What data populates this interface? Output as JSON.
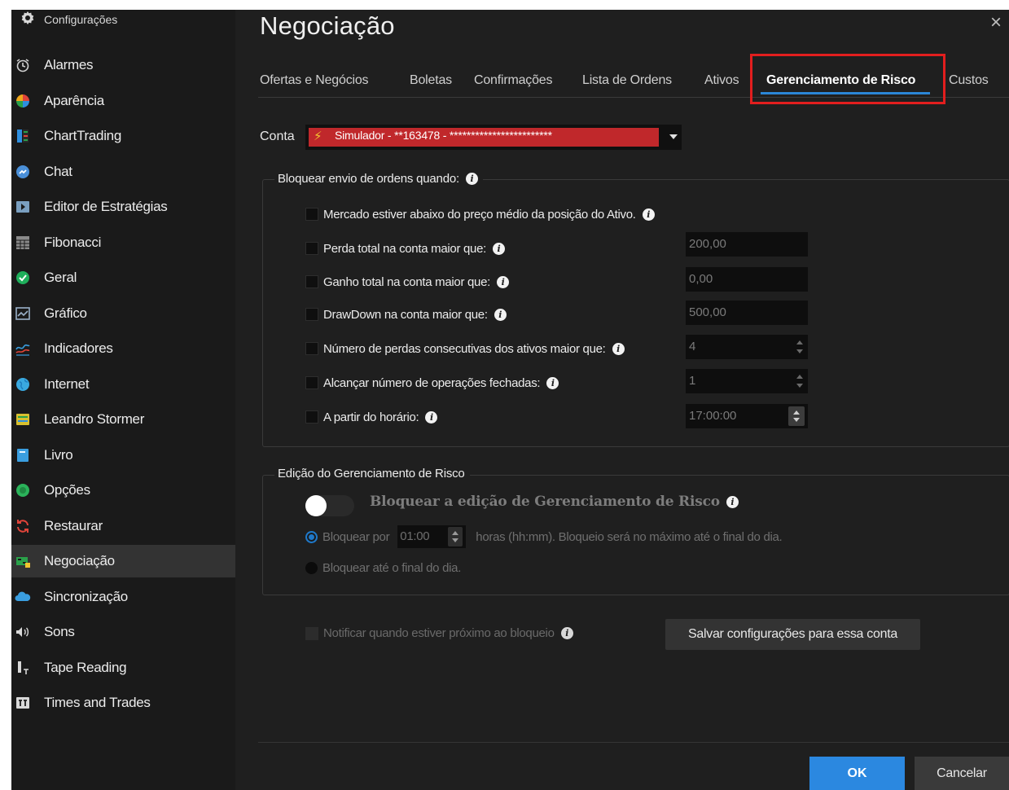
{
  "sidebar": {
    "header": {
      "label": "Configurações",
      "icon": "gear-icon"
    },
    "items": [
      {
        "label": "Alarmes",
        "icon": "alarm-clock-icon",
        "color": "#d0d0d0"
      },
      {
        "label": "Aparência",
        "icon": "palette-pie-icon",
        "color": "#f08a1c"
      },
      {
        "label": "ChartTrading",
        "icon": "chart-trading-icon",
        "color": "#2aa14a"
      },
      {
        "label": "Chat",
        "icon": "chat-bubble-icon",
        "color": "#4a8fd8"
      },
      {
        "label": "Editor de Estratégias",
        "icon": "play-box-icon",
        "color": "#7a9fc0"
      },
      {
        "label": "Fibonacci",
        "icon": "fibonacci-grid-icon",
        "color": "#8a8a8a"
      },
      {
        "label": "Geral",
        "icon": "check-circle-icon",
        "color": "#1fae5b"
      },
      {
        "label": "Gráfico",
        "icon": "line-chart-icon",
        "color": "#9ab0c8"
      },
      {
        "label": "Indicadores",
        "icon": "indicator-lines-icon",
        "color": "#3a9ee0"
      },
      {
        "label": "Internet",
        "icon": "globe-icon",
        "color": "#3aa9e0"
      },
      {
        "label": "Leandro Stormer",
        "icon": "user-card-icon",
        "color": "#d8c030"
      },
      {
        "label": "Livro",
        "icon": "book-icon",
        "color": "#3a9ee0"
      },
      {
        "label": "Opções",
        "icon": "options-circle-icon",
        "color": "#2bb35a"
      },
      {
        "label": "Restaurar",
        "icon": "restore-arrows-icon",
        "color": "#e0443a"
      },
      {
        "label": "Negociação",
        "icon": "trading-bars-icon",
        "color": "#2aa14a",
        "active": true
      },
      {
        "label": "Sincronização",
        "icon": "cloud-icon",
        "color": "#3a9ee0"
      },
      {
        "label": "Sons",
        "icon": "speaker-icon",
        "color": "#d8d8d8"
      },
      {
        "label": "Tape Reading",
        "icon": "tape-reading-icon",
        "color": "#d8d8d8"
      },
      {
        "label": "Times and Trades",
        "icon": "times-trades-icon",
        "color": "#d8d8d8"
      }
    ]
  },
  "main": {
    "title": "Negociação",
    "close_glyph": "×",
    "tabs": [
      {
        "label": "Ofertas e Negócios"
      },
      {
        "label": "Boletas"
      },
      {
        "label": "Confirmações"
      },
      {
        "label": "Lista de Ordens"
      },
      {
        "label": "Ativos"
      },
      {
        "label": "Gerenciamento de Risco",
        "active": true
      },
      {
        "label": "Custos"
      }
    ],
    "conta": {
      "label": "Conta",
      "value": "Simulador - **163478 - ************************",
      "color": "#c0282b"
    },
    "block_group": {
      "title": "Bloquear envio de ordens quando:",
      "rows": [
        {
          "label": "Mercado estiver abaixo do preço médio da posição do Ativo.",
          "checked": false
        },
        {
          "label": "Perda total na conta maior que:",
          "checked": false,
          "value": "200,00"
        },
        {
          "label": "Ganho total na conta maior que:",
          "checked": false,
          "value": "0,00"
        },
        {
          "label": "DrawDown na conta maior que:",
          "checked": false,
          "value": "500,00"
        },
        {
          "label": "Número de perdas consecutivas dos ativos maior que:",
          "checked": false,
          "value": "4"
        },
        {
          "label": "Alcançar número de operações fechadas:",
          "checked": false,
          "value": "1"
        },
        {
          "label": "A partir do horário:",
          "checked": false,
          "value": "17:00:00"
        }
      ]
    },
    "edit_group": {
      "title": "Edição do Gerenciamento de Risco",
      "toggle_label": "Bloquear a edição de Gerenciamento de Risco",
      "toggle_on": false,
      "radio1_prefix": "Bloquear por",
      "radio1_time": "01:00",
      "radio1_suffix": "horas (hh:mm). Bloqueio será no máximo até o final do dia.",
      "radio2_label": "Bloquear até o final do dia."
    },
    "notify_label": "Notificar quando estiver próximo ao bloqueio",
    "save_button": "Salvar configurações para essa conta",
    "ok_button": "OK",
    "cancel_button": "Cancelar",
    "accent": "#2b88e0",
    "highlight": "#e21e1e"
  }
}
